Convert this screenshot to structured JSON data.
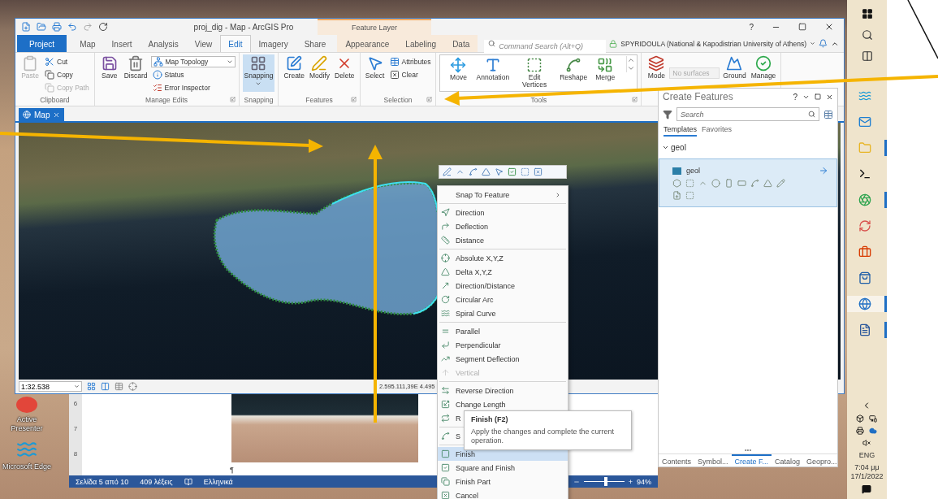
{
  "desktop_icons": [
    {
      "label": "Active Presenter"
    },
    {
      "label": "Microsoft Edge"
    }
  ],
  "window": {
    "title": "proj_dig - Map - ArcGIS Pro",
    "contextual_group": "Feature Layer",
    "help": "?"
  },
  "tabs": [
    {
      "label": "Project",
      "kind": "backstage",
      "selected": false
    },
    {
      "label": "Map",
      "kind": "normal",
      "selected": false
    },
    {
      "label": "Insert",
      "kind": "normal",
      "selected": false
    },
    {
      "label": "Analysis",
      "kind": "normal",
      "selected": false
    },
    {
      "label": "View",
      "kind": "normal",
      "selected": false
    },
    {
      "label": "Edit",
      "kind": "normal",
      "selected": true
    },
    {
      "label": "Imagery",
      "kind": "normal",
      "selected": false
    },
    {
      "label": "Share",
      "kind": "normal",
      "selected": false
    },
    {
      "label": "Appearance",
      "kind": "contextual",
      "selected": false
    },
    {
      "label": "Labeling",
      "kind": "contextual",
      "selected": false
    },
    {
      "label": "Data",
      "kind": "contextual",
      "selected": false
    }
  ],
  "command_search": {
    "placeholder": "Command Search (Alt+Q)"
  },
  "user": "SPYRIDOULA (National & Kapodistrian University of Athens)",
  "ribbon_groups": [
    {
      "label": "Clipboard",
      "buttons": [
        {
          "label": "Paste",
          "kind": "large",
          "disabled": true
        },
        {
          "label": "Cut",
          "kind": "small",
          "disabled": false
        },
        {
          "label": "Copy",
          "kind": "small",
          "disabled": false
        },
        {
          "label": "Copy Path",
          "kind": "small",
          "disabled": true
        }
      ]
    },
    {
      "label": "Manage Edits",
      "launcher": true,
      "buttons": [
        {
          "label": "Save",
          "kind": "large",
          "disabled": false
        },
        {
          "label": "Discard",
          "kind": "large",
          "disabled": false
        },
        {
          "label": "Map Topology",
          "kind": "combo",
          "disabled": false
        },
        {
          "label": "Status",
          "kind": "small",
          "disabled": false
        },
        {
          "label": "Error Inspector",
          "kind": "small",
          "disabled": false
        }
      ]
    },
    {
      "label": "Snapping",
      "buttons": [
        {
          "label": "Snapping",
          "kind": "toggle",
          "on": true,
          "disabled": false
        }
      ]
    },
    {
      "label": "Features",
      "launcher": true,
      "buttons": [
        {
          "label": "Create",
          "kind": "large",
          "disabled": false
        },
        {
          "label": "Modify",
          "kind": "large",
          "disabled": false
        },
        {
          "label": "Delete",
          "kind": "large",
          "disabled": false
        }
      ]
    },
    {
      "label": "Selection",
      "launcher": true,
      "buttons": [
        {
          "label": "Select",
          "kind": "large",
          "disabled": false
        },
        {
          "label": "Attributes",
          "kind": "small",
          "disabled": false
        },
        {
          "label": "Clear",
          "kind": "small",
          "disabled": false
        }
      ]
    },
    {
      "label": "Tools",
      "launcher": true,
      "gallery": true,
      "buttons": [
        {
          "label": "Move",
          "kind": "large",
          "disabled": false
        },
        {
          "label": "Annotation",
          "kind": "large",
          "disabled": false
        },
        {
          "label": "Edit Vertices",
          "kind": "large",
          "disabled": false
        },
        {
          "label": "Reshape",
          "kind": "large",
          "disabled": false
        },
        {
          "label": "Merge",
          "kind": "large",
          "disabled": false
        }
      ]
    },
    {
      "buttons": [
        {
          "label": "Mode",
          "kind": "large",
          "disabled": false
        },
        {
          "label": "No surfaces",
          "kind": "field",
          "disabled": true
        },
        {
          "label": "Ground",
          "kind": "large",
          "disabled": false
        },
        {
          "label": "Manage",
          "kind": "large",
          "disabled": false
        }
      ]
    }
  ],
  "map_tab": {
    "label": "Map"
  },
  "map_view": {
    "scale": "1:32.538",
    "coordinates": "2.595.111,39E 4.495"
  },
  "context_menu": {
    "groups": [
      {
        "items": [
          {
            "label": "Snap To Feature",
            "kind": "submenu",
            "disabled": false,
            "selected": false
          }
        ]
      },
      {
        "items": [
          {
            "label": "Direction",
            "kind": "item",
            "disabled": false,
            "selected": false
          },
          {
            "label": "Deflection",
            "kind": "item",
            "disabled": false,
            "selected": false
          },
          {
            "label": "Distance",
            "kind": "item",
            "disabled": false,
            "selected": false
          }
        ]
      },
      {
        "items": [
          {
            "label": "Absolute X,Y,Z",
            "kind": "item",
            "disabled": false,
            "selected": false
          },
          {
            "label": "Delta X,Y,Z",
            "kind": "item",
            "disabled": false,
            "selected": false
          },
          {
            "label": "Direction/Distance",
            "kind": "item",
            "disabled": false,
            "selected": false
          },
          {
            "label": "Circular Arc",
            "kind": "item",
            "disabled": false,
            "selected": false
          },
          {
            "label": "Spiral Curve",
            "kind": "item",
            "disabled": false,
            "selected": false
          }
        ]
      },
      {
        "items": [
          {
            "label": "Parallel",
            "kind": "item",
            "disabled": false,
            "selected": false
          },
          {
            "label": "Perpendicular",
            "kind": "item",
            "disabled": false,
            "selected": false
          },
          {
            "label": "Segment Deflection",
            "kind": "item",
            "disabled": false,
            "selected": false
          },
          {
            "label": "Vertical",
            "kind": "item",
            "disabled": true,
            "selected": false
          }
        ]
      },
      {
        "items": [
          {
            "label": "Reverse Direction",
            "kind": "item",
            "disabled": false,
            "selected": false
          },
          {
            "label": "Change Length",
            "kind": "item",
            "disabled": false,
            "selected": false
          },
          {
            "label": "R",
            "kind": "item",
            "disabled": false,
            "selected": false
          }
        ]
      },
      {
        "items": [
          {
            "label": "S",
            "kind": "item",
            "disabled": false,
            "selected": false
          }
        ]
      },
      {
        "items": [
          {
            "label": "Finish",
            "kind": "item",
            "disabled": false,
            "selected": true
          },
          {
            "label": "Square and Finish",
            "kind": "item",
            "disabled": false,
            "selected": false
          },
          {
            "label": "Finish Part",
            "kind": "item",
            "disabled": false,
            "selected": false
          },
          {
            "label": "Cancel",
            "kind": "item",
            "disabled": false,
            "selected": false
          }
        ]
      }
    ]
  },
  "tooltip": {
    "title": "Finish (F2)",
    "text": "Apply the changes and complete the current operation."
  },
  "create_features": {
    "title": "Create Features",
    "help": "?",
    "search_placeholder": "Search",
    "tabs": [
      {
        "label": "Templates",
        "selected": true
      },
      {
        "label": "Favorites",
        "selected": false
      }
    ],
    "layer": {
      "name": "geol",
      "expanded": true,
      "templates": [
        {
          "name": "geol",
          "selected": true
        }
      ]
    },
    "more": "•••",
    "bottom_tabs": [
      {
        "label": "Contents",
        "selected": false
      },
      {
        "label": "Symbol...",
        "selected": false
      },
      {
        "label": "Create F...",
        "selected": true
      },
      {
        "label": "Catalog",
        "selected": false
      },
      {
        "label": "Geopro...",
        "selected": false
      }
    ]
  },
  "word": {
    "ruler_numbers": [
      "6",
      "7",
      "8"
    ],
    "pilcrow": "¶",
    "status": [
      "Σελίδα 5 από 10",
      "409 λέξεις",
      "Ελληνικά"
    ],
    "zoom": {
      "level": 0.55,
      "plus": "+",
      "reading": "94%"
    }
  },
  "taskbar": {
    "apps": [
      {
        "running": false,
        "selected": false
      },
      {
        "running": false,
        "selected": false
      },
      {
        "running": true,
        "selected": false
      },
      {
        "running": false,
        "selected": false
      },
      {
        "running": true,
        "selected": false
      },
      {
        "running": false,
        "selected": false
      },
      {
        "running": false,
        "selected": false
      },
      {
        "running": false,
        "selected": false
      },
      {
        "running": true,
        "selected": true
      },
      {
        "running": true,
        "selected": false
      }
    ],
    "language": "ENG",
    "time": "7:04 μμ",
    "date": "17/1/2022"
  }
}
